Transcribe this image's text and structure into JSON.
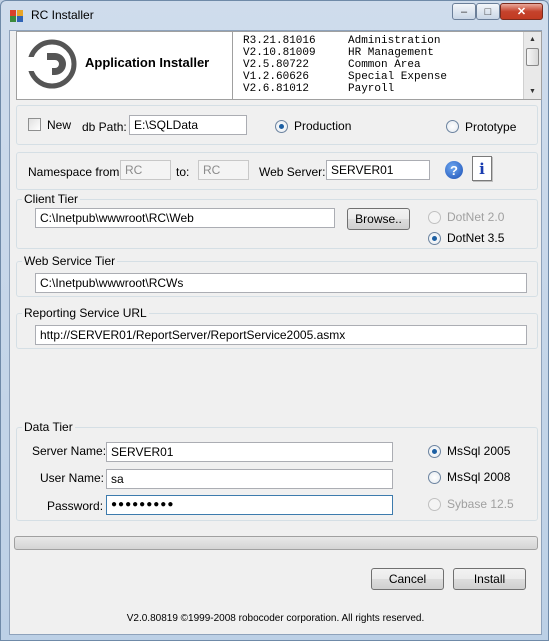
{
  "window": {
    "title": "RC Installer",
    "close_symbol": "✕",
    "minimize_symbol": "–",
    "maximize_symbol": "□"
  },
  "header": {
    "app_title": "Application Installer",
    "versions": [
      {
        "version": "R3.21.81016",
        "module": "Administration"
      },
      {
        "version": "V2.10.81009",
        "module": "HR Management"
      },
      {
        "version": "V2.5.80722",
        "module": "Common Area"
      },
      {
        "version": "V1.2.60626",
        "module": "Special Expense"
      },
      {
        "version": "V2.6.81012",
        "module": "Payroll"
      }
    ]
  },
  "options": {
    "new_label": "New",
    "db_path_label": "db Path:",
    "db_path_value": "E:\\SQLData",
    "production_label": "Production",
    "prototype_label": "Prototype"
  },
  "namespace": {
    "from_label": "Namespace from:",
    "from_value": "RC",
    "to_label": "to:",
    "to_value": "RC",
    "web_server_label": "Web Server:",
    "web_server_value": "SERVER01",
    "help_glyph": "?",
    "info_glyph": "i"
  },
  "client_tier": {
    "label": "Client Tier",
    "path": "C:\\Inetpub\\wwwroot\\RC\\Web",
    "browse_label": "Browse..",
    "dotnet20_label": "DotNet 2.0",
    "dotnet35_label": "DotNet 3.5"
  },
  "web_service_tier": {
    "label": "Web Service Tier",
    "path": "C:\\Inetpub\\wwwroot\\RCWs"
  },
  "reporting": {
    "label": "Reporting Service URL",
    "url": "http://SERVER01/ReportServer/ReportService2005.asmx"
  },
  "data_tier": {
    "label": "Data Tier",
    "server_name_label": "Server Name:",
    "server_name_value": "SERVER01",
    "user_name_label": "User Name:",
    "user_name_value": "sa",
    "password_label": "Password:",
    "password_value": "●●●●●●●●●",
    "mssql2005_label": "MsSql 2005",
    "mssql2008_label": "MsSql 2008",
    "sybase_label": "Sybase 12.5"
  },
  "actions": {
    "cancel_label": "Cancel",
    "install_label": "Install"
  },
  "footer": {
    "text": "V2.0.80819 ©1999-2008 robocoder corporation. All rights reserved."
  }
}
